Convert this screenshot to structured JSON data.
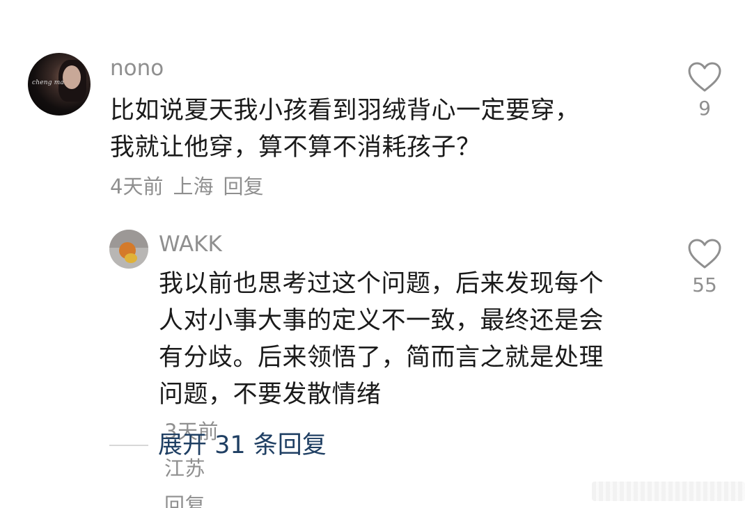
{
  "comment": {
    "username": "nono",
    "avatar_text": "cheng man",
    "text_lines": [
      "比如说夏天我小孩看到羽绒背心一定要穿，",
      "我就让他穿，算不算不消耗孩子？"
    ],
    "time": "4天前",
    "location": "上海",
    "reply_label": "回复",
    "like_count": "9",
    "like_icon": "heart-outline-icon"
  },
  "reply": {
    "username": "WAKK",
    "text_lines": [
      "我以前也思考过这个问题，后来发现每个",
      "人对小事大事的定义不一致，最终还是会",
      "有分歧。后来领悟了，简而言之就是处理",
      "问题，不要发散情绪"
    ],
    "time": "3天前",
    "location": "江苏",
    "reply_label": "回复",
    "like_count": "55",
    "like_icon": "heart-outline-icon"
  },
  "expand": {
    "label": "展开 31 条回复"
  },
  "colors": {
    "text": "#1a1a1a",
    "muted": "#8f8f8f",
    "link": "#1f3f63"
  }
}
